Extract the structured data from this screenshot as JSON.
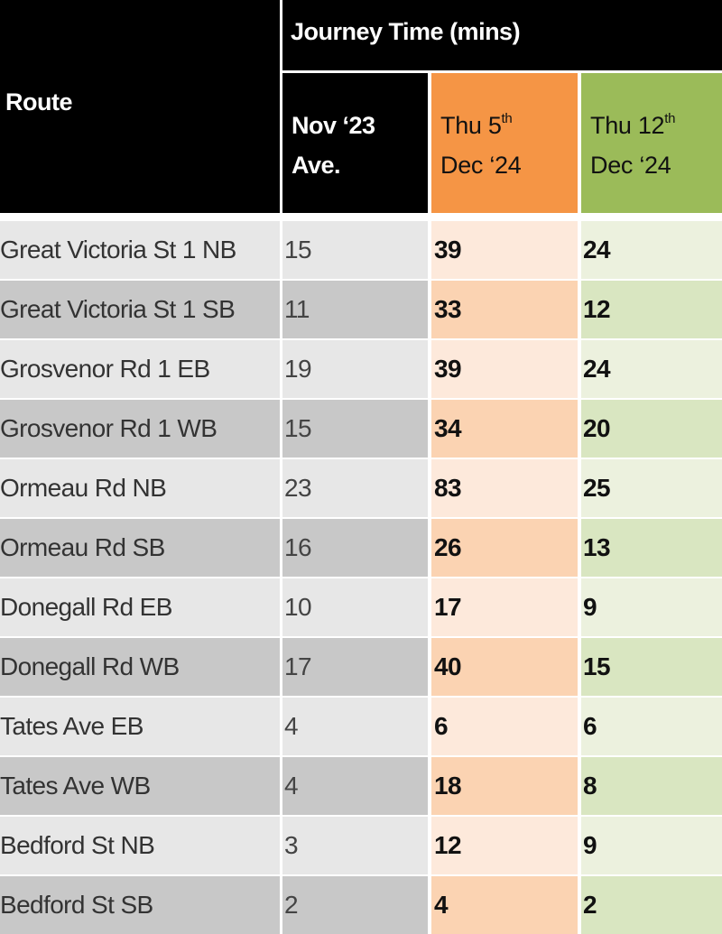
{
  "colors": {
    "header_bg": "#000000",
    "thu5_accent": "#f59545",
    "thu12_accent": "#9bbb59"
  },
  "header": {
    "route": "Route",
    "group": "Journey Time (mins)",
    "columns": [
      {
        "line1": "Nov ‘23",
        "line2": "Ave.",
        "sup": ""
      },
      {
        "line1": "Thu 5",
        "sup": "th",
        "line2": "Dec ‘24"
      },
      {
        "line1": "Thu 12",
        "sup": "th",
        "line2": "Dec ‘24"
      }
    ]
  },
  "rows": [
    {
      "route": "Great Victoria St 1 NB",
      "nov23": "15",
      "thu5": "39",
      "thu12": "24"
    },
    {
      "route": "Great Victoria St 1 SB",
      "nov23": "11",
      "thu5": "33",
      "thu12": "12"
    },
    {
      "route": "Grosvenor Rd 1 EB",
      "nov23": "19",
      "thu5": "39",
      "thu12": "24"
    },
    {
      "route": "Grosvenor Rd 1 WB",
      "nov23": "15",
      "thu5": "34",
      "thu12": "20"
    },
    {
      "route": "Ormeau Rd NB",
      "nov23": "23",
      "thu5": "83",
      "thu12": "25"
    },
    {
      "route": "Ormeau Rd SB",
      "nov23": "16",
      "thu5": "26",
      "thu12": "13"
    },
    {
      "route": "Donegall Rd EB",
      "nov23": "10",
      "thu5": "17",
      "thu12": "9"
    },
    {
      "route": "Donegall Rd WB",
      "nov23": "17",
      "thu5": "40",
      "thu12": "15"
    },
    {
      "route": "Tates Ave EB",
      "nov23": "4",
      "thu5": "6",
      "thu12": "6"
    },
    {
      "route": "Tates Ave WB",
      "nov23": "4",
      "thu5": "18",
      "thu12": "8"
    },
    {
      "route": "Bedford St NB",
      "nov23": "3",
      "thu5": "12",
      "thu12": "9"
    },
    {
      "route": "Bedford St SB",
      "nov23": "2",
      "thu5": "4",
      "thu12": "2"
    }
  ]
}
